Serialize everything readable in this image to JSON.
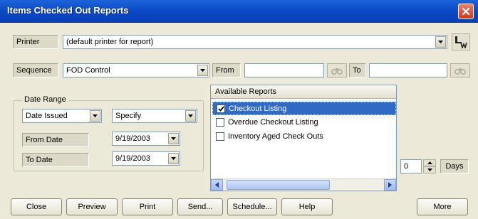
{
  "window": {
    "title": "Items Checked Out Reports"
  },
  "printer": {
    "label": "Printer",
    "value": "(default printer for report)"
  },
  "sequence": {
    "label": "Sequence",
    "value": "FOD Control",
    "from_label": "From",
    "from_value": "",
    "to_label": "To",
    "to_value": ""
  },
  "date_range": {
    "title": "Date Range",
    "type_value": "Date Issued",
    "mode_value": "Specify",
    "from_label": "From Date",
    "from_value": "9/19/2003",
    "to_label": "To Date",
    "to_value": "9/19/2003"
  },
  "reports": {
    "header": "Available Reports",
    "items": [
      {
        "label": "Checkout Listing",
        "checked": true,
        "selected": true
      },
      {
        "label": "Overdue Checkout Listing",
        "checked": false,
        "selected": false
      },
      {
        "label": "Inventory Aged Check Outs",
        "checked": false,
        "selected": false
      }
    ]
  },
  "days": {
    "value": "0",
    "label": "Days"
  },
  "buttons": {
    "close": "Close",
    "preview": "Preview",
    "print": "Print",
    "send": "Send...",
    "schedule": "Schedule...",
    "help": "Help",
    "more": "More"
  },
  "colors": {
    "titlebar": "#0a48c4",
    "dialog_bg": "#ece9d8",
    "selection": "#316ac5",
    "close_button": "#c8391a"
  },
  "icons": {
    "printer_setup": "printer-setup-icon",
    "from_lookup": "binoculars-icon",
    "to_lookup": "binoculars-icon",
    "close": "close-x-icon"
  }
}
